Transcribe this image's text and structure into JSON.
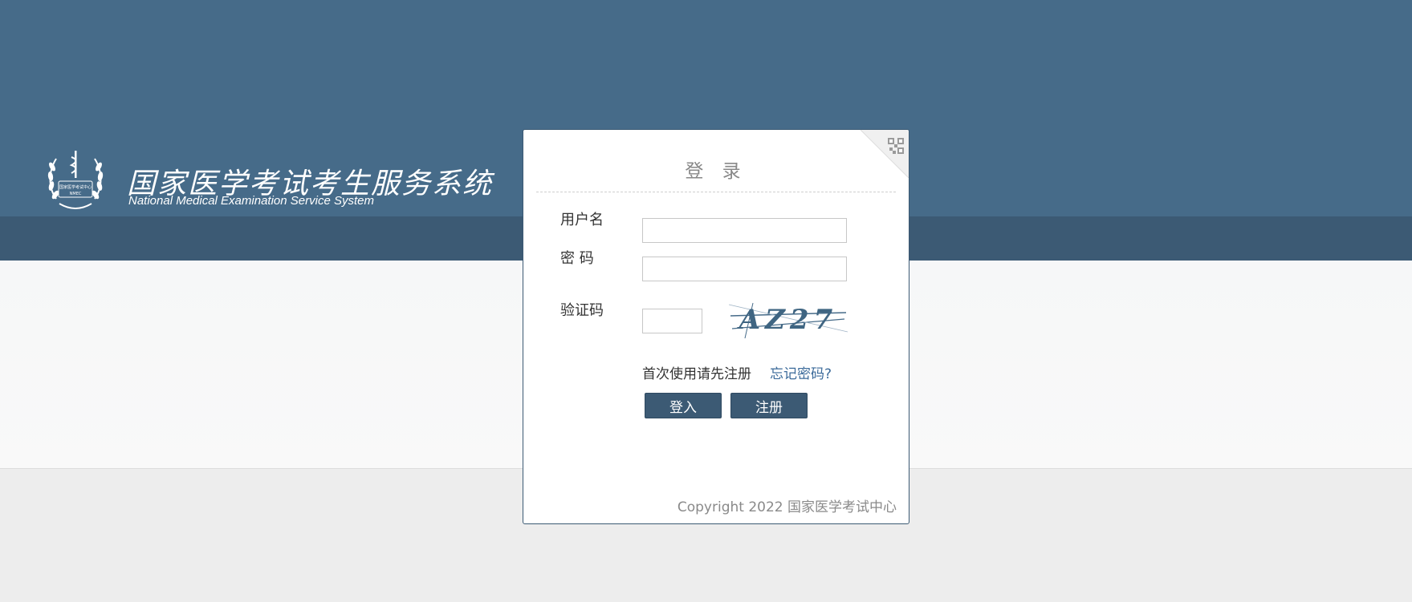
{
  "header": {
    "title_cn": "国家医学考试考生服务系统",
    "title_en": "National Medical Examination Service System",
    "logo": {
      "icon": "emblem-icon",
      "text": "国家医学考试中心",
      "abbr": "NMEC"
    }
  },
  "login": {
    "title": "登 录",
    "qr_icon": "qr-code-icon",
    "username": {
      "label": "用户名",
      "value": "",
      "placeholder": ""
    },
    "password": {
      "label": "密 码",
      "value": "",
      "placeholder": ""
    },
    "captcha": {
      "label": "验证码",
      "value": "",
      "image_text": "AZ27"
    },
    "hint": "首次使用请先注册",
    "forgot_link": "忘记密码?",
    "login_button": "登入",
    "register_button": "注册",
    "copyright": "Copyright 2022 国家医学考试中心"
  },
  "colors": {
    "header_bg": "#466b89",
    "nav_bg": "#3c5a74",
    "button_bg": "#3c5a74",
    "link": "#3b6a9a"
  }
}
